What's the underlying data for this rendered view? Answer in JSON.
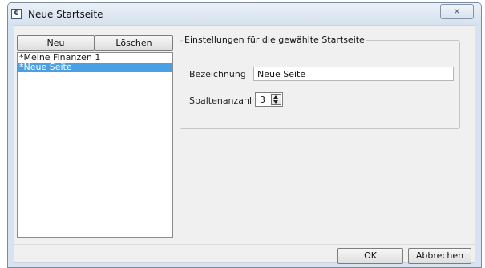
{
  "window": {
    "title": "Neue Startseite",
    "app_icon": "€",
    "close_glyph": "✕"
  },
  "toolbar": {
    "new_label": "Neu",
    "delete_label": "Löschen"
  },
  "pages": {
    "items": [
      {
        "label": "*Meine Finanzen 1",
        "selected": false
      },
      {
        "label": "*Neue Seite",
        "selected": true
      }
    ]
  },
  "settings": {
    "group_title": "Einstellungen für die gewählte Startseite",
    "name_label": "Bezeichnung",
    "name_value": "Neue Seite",
    "columns_label": "Spaltenanzahl",
    "columns_value": "3"
  },
  "footer": {
    "ok_label": "OK",
    "cancel_label": "Abbrechen"
  },
  "colors": {
    "selection": "#4aa0e5",
    "titlebar": "#d7e3f0"
  }
}
